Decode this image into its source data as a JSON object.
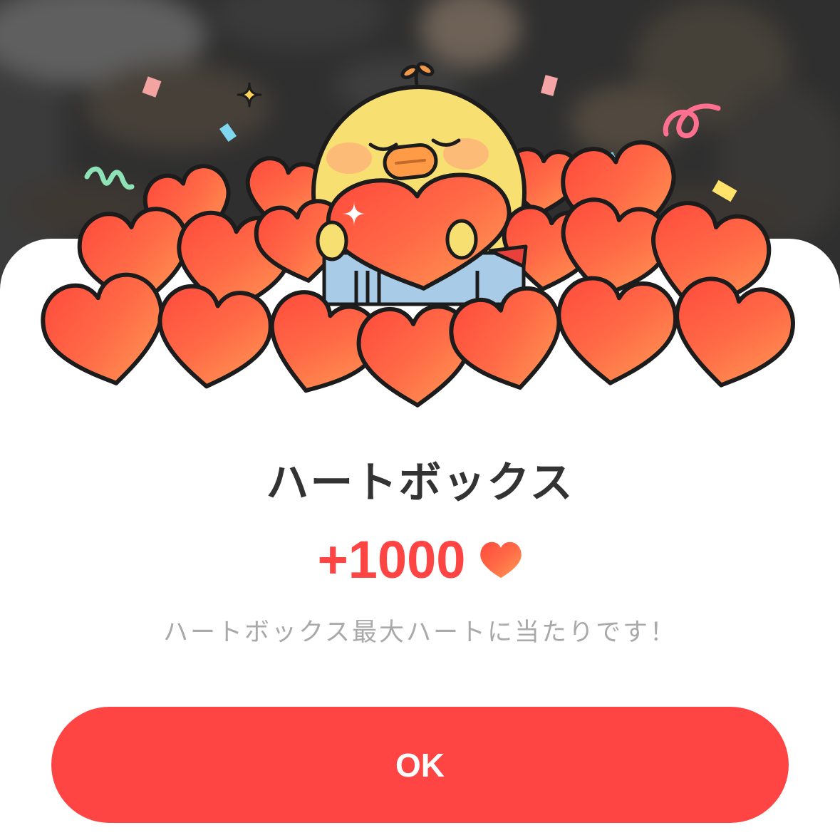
{
  "dialog": {
    "title": "ハートボックス",
    "amount": "+1000",
    "message": "ハートボックス最大ハートに当たりです！",
    "ok_label": "OK"
  },
  "icons": {
    "amount": "heart-icon",
    "mascot": "chick-icon",
    "sparkle": "sparkle-icon"
  },
  "colors": {
    "accent": "#ff4444",
    "title": "#333333",
    "message": "#a9a9a9",
    "heart_start": "#ff4a3d",
    "heart_mid": "#ff6a46",
    "heart_end": "#ff9d55",
    "mascot": "#f8df72",
    "backdrop": "#2f2f2f"
  }
}
